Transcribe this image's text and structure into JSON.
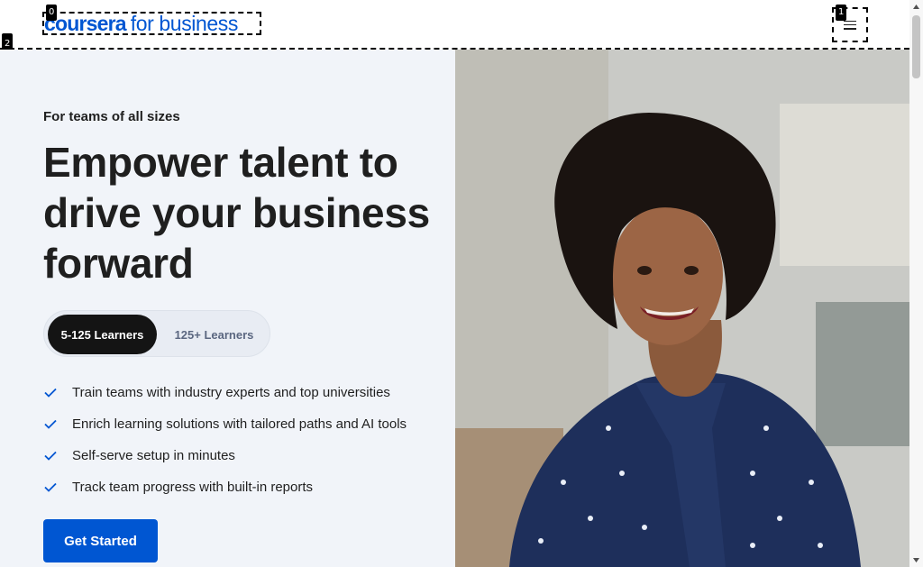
{
  "header": {
    "logo_main": "coursera",
    "logo_sub": "for business",
    "menu_icon": "hamburger-menu-icon"
  },
  "badges": [
    "0",
    "1",
    "2"
  ],
  "hero": {
    "eyebrow": "For teams of all sizes",
    "headline": "Empower talent to drive your business forward",
    "toggle": {
      "options": [
        "5-125 Learners",
        "125+ Learners"
      ],
      "selected": "5-125 Learners"
    },
    "features": [
      "Train teams with industry experts and top universities",
      "Enrich learning solutions with tailored paths and AI tools",
      "Self-serve setup in minutes",
      "Track team progress with built-in reports"
    ],
    "cta_label": "Get Started",
    "photo_icon": "smiling-woman-photo"
  },
  "colors": {
    "brand_blue": "#0056d2",
    "hero_bg": "#f1f4f9",
    "toggle_active": "#141414",
    "text_primary": "#1f1f1f"
  }
}
